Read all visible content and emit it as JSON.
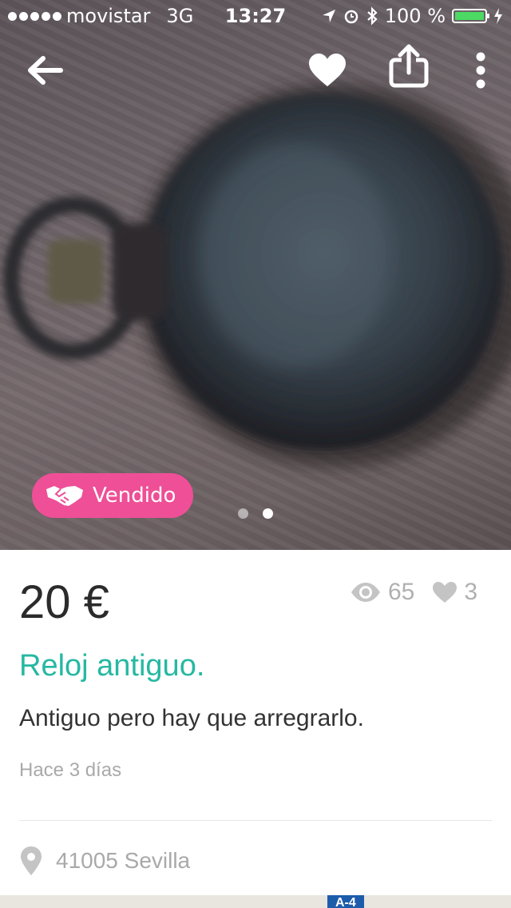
{
  "status_bar": {
    "carrier": "movistar",
    "network": "3G",
    "time": "13:27",
    "battery": "100 %"
  },
  "product": {
    "price": "20 €",
    "views": "65",
    "likes": "3",
    "title": "Reloj antiguo.",
    "description": "Antiguo pero hay que arregrarlo.",
    "posted": "Hace 3 días",
    "location": "41005 Sevilla",
    "sold_label": "Vendido"
  },
  "gallery": {
    "total_photos": 2,
    "current_photo": 2
  },
  "map": {
    "road_label": "A-4"
  },
  "colors": {
    "accent_teal": "#26b8a2",
    "sold_pink": "#ee4f96",
    "battery_green": "#4cd964",
    "road_blue": "#1d5cab"
  },
  "icons": [
    "back-arrow-icon",
    "heart-icon",
    "share-icon",
    "more-vertical-icon",
    "handshake-icon",
    "eye-icon",
    "heart-small-icon",
    "location-pin-icon"
  ]
}
